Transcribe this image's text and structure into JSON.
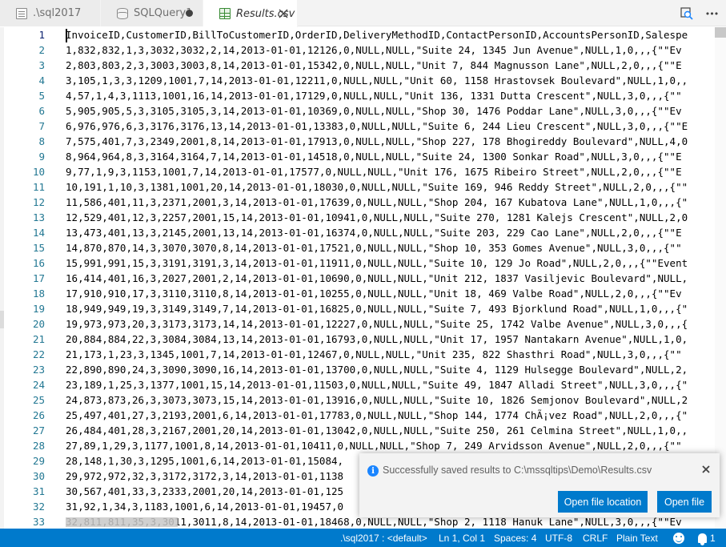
{
  "tabs": [
    {
      "label": ".\\sql2017",
      "icon": "file-icon",
      "state": "inactive"
    },
    {
      "label": "SQLQuery1",
      "icon": "database-icon",
      "state": "dirty"
    },
    {
      "label": "Results.csv",
      "icon": "csv-file-icon",
      "state": "active"
    }
  ],
  "toolbar": {
    "icons": [
      "open-preview-icon",
      "more-actions-icon"
    ],
    "more_label": "•••"
  },
  "editor": {
    "line_numbers": [
      "1",
      "2",
      "3",
      "4",
      "5",
      "6",
      "7",
      "8",
      "9",
      "10",
      "11",
      "12",
      "13",
      "14",
      "15",
      "16",
      "17",
      "18",
      "19",
      "20",
      "21",
      "22",
      "23",
      "24",
      "25",
      "26",
      "27",
      "28",
      "29",
      "30",
      "31",
      "32",
      "33"
    ],
    "lines": [
      "InvoiceID,CustomerID,BillToCustomerID,OrderID,DeliveryMethodID,ContactPersonID,AccountsPersonID,Salespe",
      "1,832,832,1,3,3032,3032,2,14,2013-01-01,12126,0,NULL,NULL,\"Suite 24, 1345 Jun Avenue\",NULL,1,0,,,{\"\"Ev",
      "2,803,803,2,3,3003,3003,8,14,2013-01-01,15342,0,NULL,NULL,\"Unit 7, 844 Magnusson Lane\",NULL,2,0,,,{\"\"E",
      "3,105,1,3,3,1209,1001,7,14,2013-01-01,12211,0,NULL,NULL,\"Unit 60, 1158 Hrastovsek Boulevard\",NULL,1,0,,",
      "4,57,1,4,3,1113,1001,16,14,2013-01-01,17129,0,NULL,NULL,\"Unit 136, 1331 Dutta Crescent\",NULL,3,0,,,{\"\"",
      "5,905,905,5,3,3105,3105,3,14,2013-01-01,10369,0,NULL,NULL,\"Shop 30, 1476 Poddar Lane\",NULL,3,0,,,{\"\"Ev",
      "6,976,976,6,3,3176,3176,13,14,2013-01-01,13383,0,NULL,NULL,\"Suite 6, 244 Lieu Crescent\",NULL,3,0,,,{\"\"E",
      "7,575,401,7,3,2349,2001,8,14,2013-01-01,17913,0,NULL,NULL,\"Shop 227, 178 Bhogireddy Boulevard\",NULL,4,0",
      "8,964,964,8,3,3164,3164,7,14,2013-01-01,14518,0,NULL,NULL,\"Suite 24, 1300 Sonkar Road\",NULL,3,0,,,{\"\"E",
      "9,77,1,9,3,1153,1001,7,14,2013-01-01,17577,0,NULL,NULL,\"Unit 176, 1675 Ribeiro Street\",NULL,2,0,,,{\"\"E",
      "10,191,1,10,3,1381,1001,20,14,2013-01-01,18030,0,NULL,NULL,\"Suite 169, 946 Reddy Street\",NULL,2,0,,,{\"\"",
      "11,586,401,11,3,2371,2001,3,14,2013-01-01,17639,0,NULL,NULL,\"Shop 204, 167 Kubatova Lane\",NULL,1,0,,,{\"",
      "12,529,401,12,3,2257,2001,15,14,2013-01-01,10941,0,NULL,NULL,\"Suite 270, 1281 Kalejs Crescent\",NULL,2,0",
      "13,473,401,13,3,2145,2001,13,14,2013-01-01,16374,0,NULL,NULL,\"Suite 203, 229 Cao Lane\",NULL,2,0,,,{\"\"E",
      "14,870,870,14,3,3070,3070,8,14,2013-01-01,17521,0,NULL,NULL,\"Shop 10, 353 Gomes Avenue\",NULL,3,0,,,{\"\"",
      "15,991,991,15,3,3191,3191,3,14,2013-01-01,11911,0,NULL,NULL,\"Suite 10, 129 Jo Road\",NULL,2,0,,,{\"\"Event",
      "16,414,401,16,3,2027,2001,2,14,2013-01-01,10690,0,NULL,NULL,\"Unit 212, 1837 Vasiljevic Boulevard\",NULL,",
      "17,910,910,17,3,3110,3110,8,14,2013-01-01,10255,0,NULL,NULL,\"Unit 18, 469 Valbe Road\",NULL,2,0,,,{\"\"Ev",
      "18,949,949,19,3,3149,3149,7,14,2013-01-01,16825,0,NULL,NULL,\"Suite 7, 493 Bjorklund Road\",NULL,1,0,,,{\"",
      "19,973,973,20,3,3173,3173,14,14,2013-01-01,12227,0,NULL,NULL,\"Suite 25, 1742 Valbe Avenue\",NULL,3,0,,,{",
      "20,884,884,22,3,3084,3084,13,14,2013-01-01,16793,0,NULL,NULL,\"Unit 17, 1957 Nantakarn Avenue\",NULL,1,0,",
      "21,173,1,23,3,1345,1001,7,14,2013-01-01,12467,0,NULL,NULL,\"Unit 235, 822 Shasthri Road\",NULL,3,0,,,{\"\"",
      "22,890,890,24,3,3090,3090,16,14,2013-01-01,13700,0,NULL,NULL,\"Suite 4, 1129 Hulsegge Boulevard\",NULL,2,",
      "23,189,1,25,3,1377,1001,15,14,2013-01-01,11503,0,NULL,NULL,\"Suite 49, 1847 Alladi Street\",NULL,3,0,,,{\"",
      "24,873,873,26,3,3073,3073,15,14,2013-01-01,13916,0,NULL,NULL,\"Suite 10, 1826 Semjonov Boulevard\",NULL,2",
      "25,497,401,27,3,2193,2001,6,14,2013-01-01,17783,0,NULL,NULL,\"Shop 144, 1774 ChÃ¡vez Road\",NULL,2,0,,,{\"",
      "26,484,401,28,3,2167,2001,20,14,2013-01-01,13042,0,NULL,NULL,\"Suite 250, 261 Celmina Street\",NULL,1,0,,",
      "27,89,1,29,3,1177,1001,8,14,2013-01-01,10411,0,NULL,NULL,\"Shop 7, 249 Arvidsson Avenue\",NULL,2,0,,,{\"\"",
      "28,148,1,30,3,1295,1001,6,14,2013-01-01,15084,",
      "29,972,972,32,3,3172,3172,3,14,2013-01-01,1138",
      "30,567,401,33,3,2333,2001,20,14,2013-01-01,125",
      "31,92,1,34,3,1183,1001,6,14,2013-01-01,19457,0",
      "32,811,811,35,3,3011,3011,8,14,2013-01-01,18468,0,NULL,NULL,\"Shop 2, 1118 Hanuk Lane\",NULL,3,0,,,{\"\"Ev"
    ]
  },
  "notification": {
    "icon": "info-icon",
    "message": "Successfully saved results to C:\\mssqltips\\Demo\\Results.csv",
    "buttons": [
      "Open file location",
      "Open file"
    ],
    "info_glyph": "i",
    "close_glyph": "×"
  },
  "statusbar": {
    "connection": ".\\sql2017 : <default>",
    "position": "Ln 1, Col 1",
    "spaces": "Spaces: 4",
    "encoding": "UTF-8",
    "eol": "CRLF",
    "language": "Plain Text",
    "notifications_count": "1"
  },
  "colors": {
    "accent": "#007acc",
    "line_number": "#237893",
    "csv_icon": "#388a34"
  }
}
